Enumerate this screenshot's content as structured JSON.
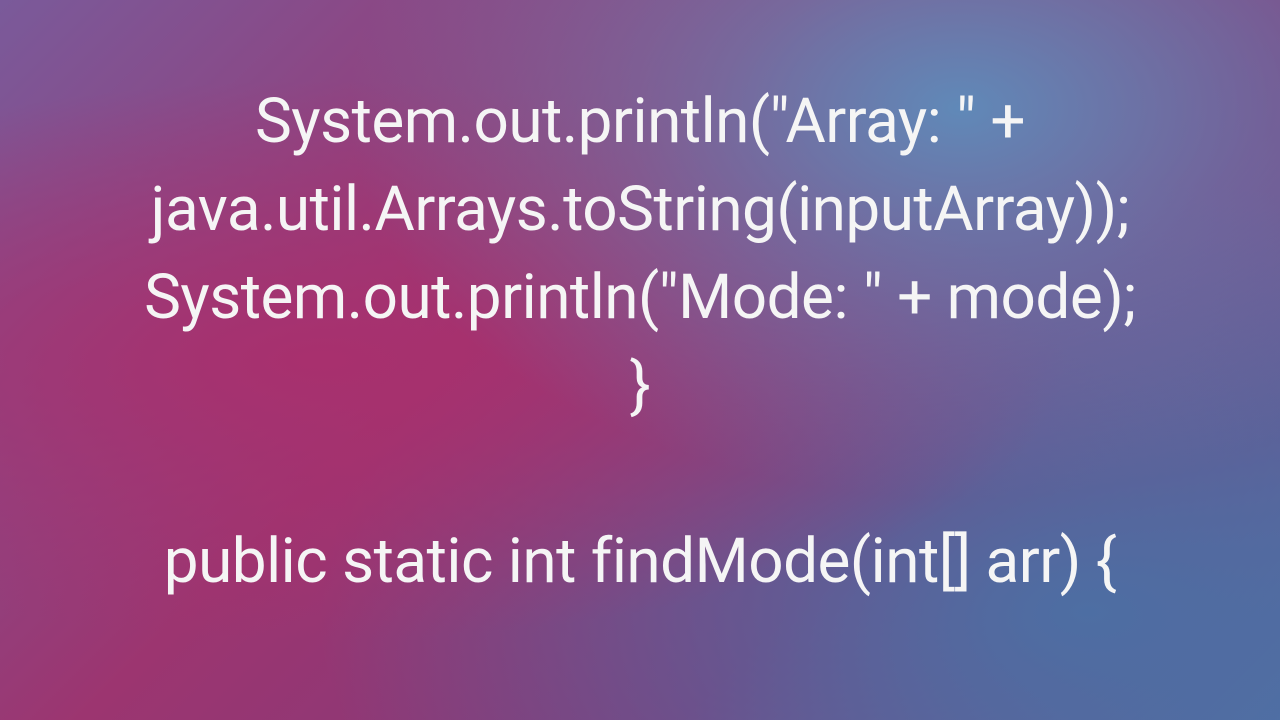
{
  "code": {
    "line1": "System.out.println(\"Array: \" + java.util.Arrays.toString(inputArray));",
    "line2": "System.out.println(\"Mode: \" + mode);",
    "line3": "}",
    "line4": "",
    "line5": "public static int findMode(int[] arr) {"
  }
}
